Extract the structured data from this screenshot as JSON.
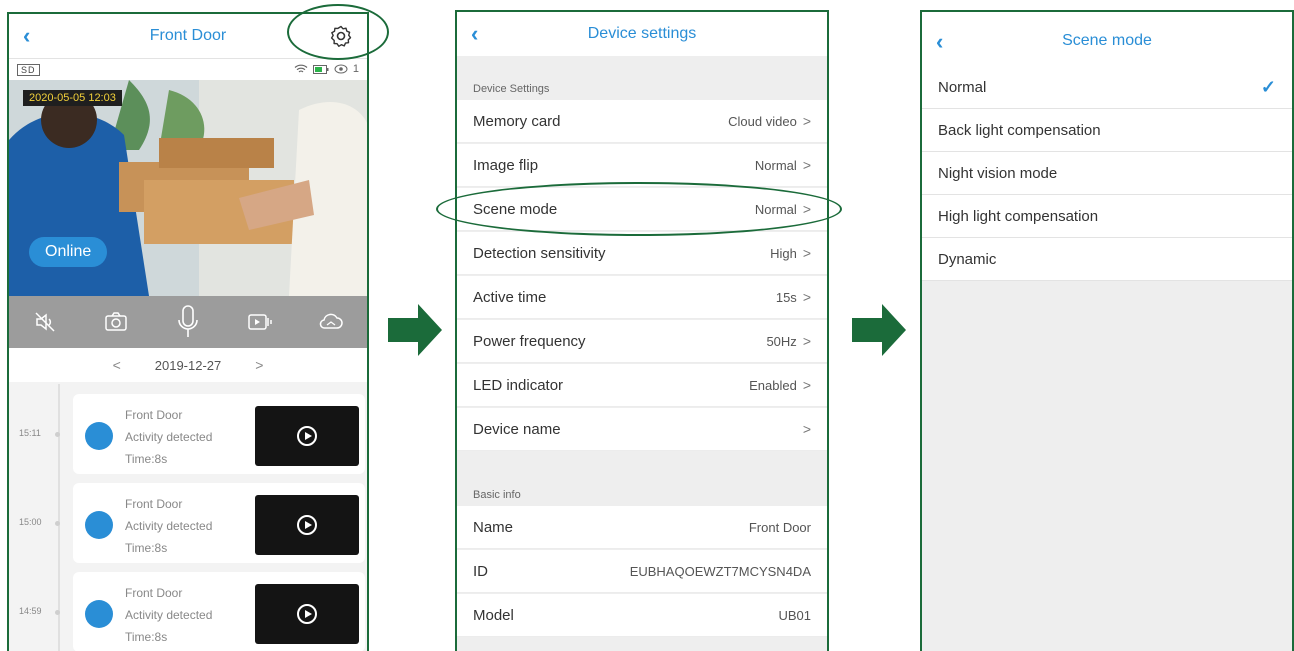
{
  "colors": {
    "accent": "#2a8ed6",
    "frame": "#1b6b3a",
    "arrow": "#1b6b3a",
    "timestamp": "#f4d23a"
  },
  "panel1": {
    "header": {
      "back": "‹",
      "title": "Front Door",
      "settings_icon": "gear-icon"
    },
    "status": {
      "quality": "SD",
      "icons": "wifi-icon battery-icon eye-icon",
      "viewers": "1"
    },
    "video": {
      "timestamp": "2020-05-05   12:03",
      "online_label": "Online"
    },
    "controls": [
      "mute-icon",
      "snapshot-icon",
      "microphone-icon",
      "record-icon",
      "cloud-icon"
    ],
    "datebar": {
      "prev": "<",
      "date": "2019-12-27",
      "next": ">"
    },
    "events": [
      {
        "time": "15:11",
        "name": "Front Door",
        "activity": "Activity detected",
        "duration": "Time:8s"
      },
      {
        "time": "15:00",
        "name": "Front Door",
        "activity": "Activity detected",
        "duration": "Time:8s"
      },
      {
        "time": "14:59",
        "name": "Front Door",
        "activity": "Activity detected",
        "duration": "Time:8s"
      }
    ]
  },
  "panel2": {
    "header": {
      "back": "‹",
      "title": "Device settings"
    },
    "section1": "Device Settings",
    "settings": [
      {
        "label": "Memory card",
        "value": "Cloud video"
      },
      {
        "label": "Image flip",
        "value": "Normal"
      },
      {
        "label": "Scene mode",
        "value": "Normal"
      },
      {
        "label": "Detection sensitivity",
        "value": "High"
      },
      {
        "label": "Active time",
        "value": "15s"
      },
      {
        "label": "Power frequency",
        "value": "50Hz"
      },
      {
        "label": "LED indicator",
        "value": "Enabled"
      },
      {
        "label": "Device name",
        "value": ""
      }
    ],
    "section2": "Basic info",
    "info": [
      {
        "label": "Name",
        "value": "Front Door"
      },
      {
        "label": "ID",
        "value": "EUBHAQOEWZT7MCYSN4DA"
      },
      {
        "label": "Model",
        "value": "UB01"
      }
    ],
    "chevron": ">"
  },
  "panel3": {
    "header": {
      "back": "‹",
      "title": "Scene mode"
    },
    "options": [
      {
        "label": "Normal",
        "mark": "✓"
      },
      {
        "label": "Back light compensation",
        "mark": ""
      },
      {
        "label": "Night vision mode",
        "mark": ""
      },
      {
        "label": "High light compensation",
        "mark": ""
      },
      {
        "label": "Dynamic",
        "mark": ""
      }
    ]
  }
}
